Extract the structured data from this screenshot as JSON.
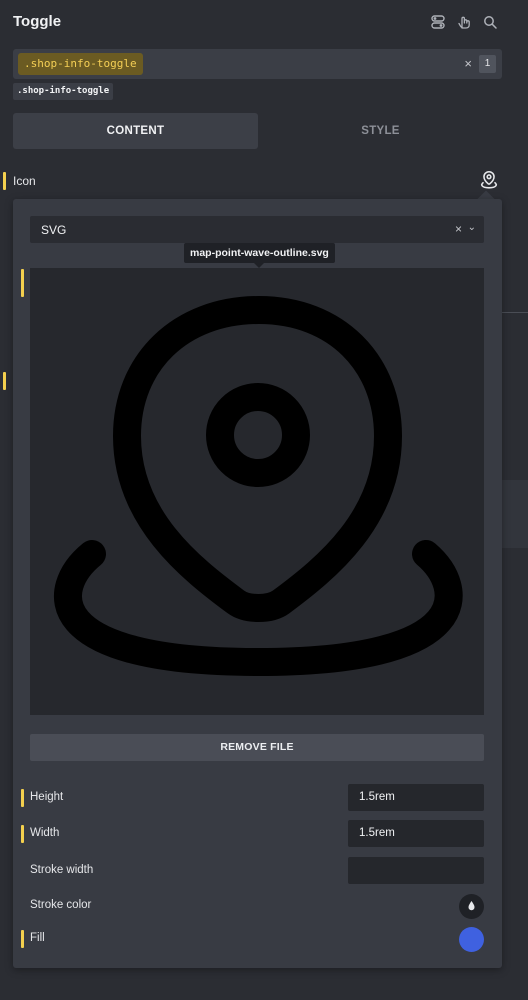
{
  "header": {
    "title": "Toggle",
    "icons": [
      "toggle-icon",
      "hand-pointer-icon",
      "search-icon"
    ]
  },
  "selector": {
    "active_tag": ".shop-info-toggle",
    "count": "1",
    "clear_symbol": "×",
    "chip": ".shop-info-toggle"
  },
  "tabs": [
    {
      "label": "CONTENT",
      "active": true
    },
    {
      "label": "STYLE",
      "active": false
    }
  ],
  "icon_control": {
    "label": "Icon",
    "icon_name": "map-point-wave-icon"
  },
  "popup": {
    "type_select_value": "SVG",
    "type_select_clear": "×",
    "type_select_chevron": "⌄",
    "filename": "map-point-wave-outline.svg",
    "remove_label": "REMOVE FILE",
    "properties": [
      {
        "label": "Height",
        "value": "1.5rem",
        "kind": "input"
      },
      {
        "label": "Width",
        "value": "1.5rem",
        "kind": "input"
      },
      {
        "label": "Stroke width",
        "value": "",
        "kind": "input"
      },
      {
        "label": "Stroke color",
        "kind": "color",
        "color": "#1f2126"
      },
      {
        "label": "Fill",
        "kind": "color",
        "color": "#3f61e0"
      }
    ]
  },
  "colors": {
    "accent_yellow": "#f4d04e",
    "fill_blue": "#3f61e0"
  }
}
